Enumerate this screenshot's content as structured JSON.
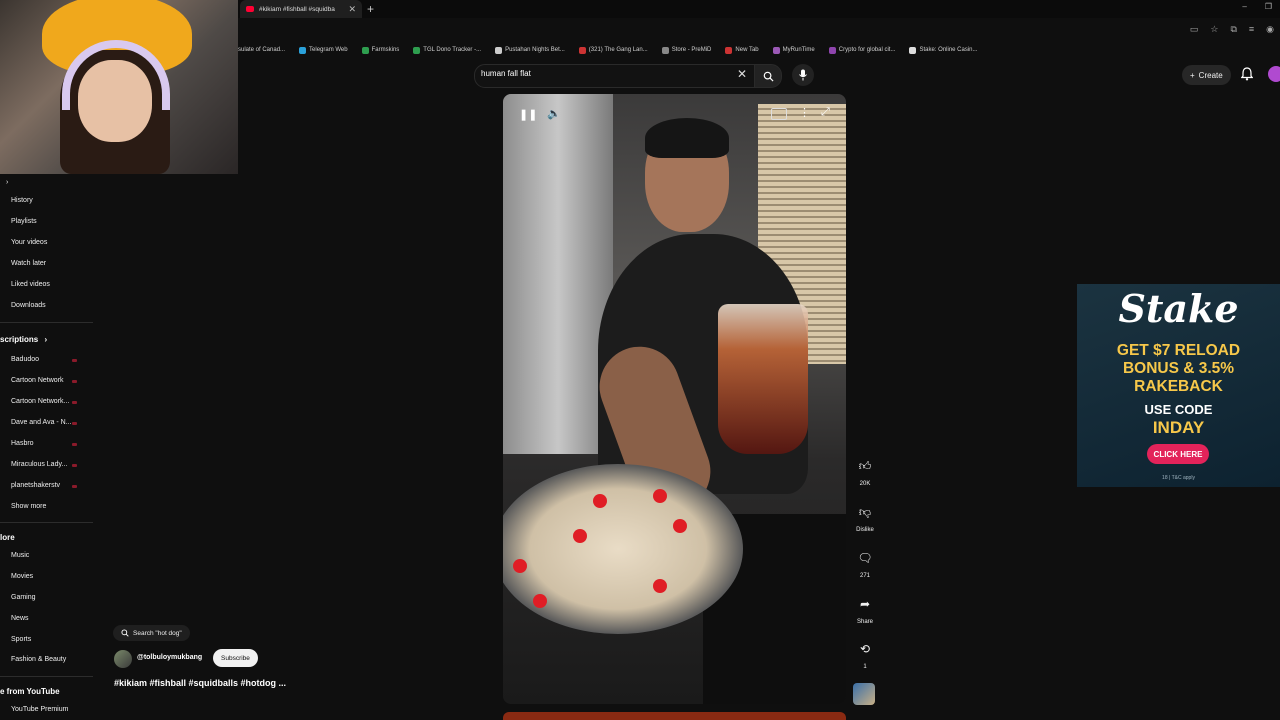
{
  "browser": {
    "tab_title": "#kikiam #fishball #squidba",
    "bookmarks": [
      "sulate of Canad...",
      "Telegram Web",
      "Farmskins",
      "TGL Dono Tracker -...",
      "Pustahan Nights Bet...",
      "(321) The Gang Lan...",
      "Store - PreMiD",
      "New Tab",
      "MyRunTime",
      "Crypto for global cit...",
      "Stake: Online Casin..."
    ]
  },
  "header": {
    "search_value": "human fall flat",
    "create_label": "Create"
  },
  "sidebar": {
    "you_items": [
      "History",
      "Playlists",
      "Your videos",
      "Watch later",
      "Liked videos",
      "Downloads"
    ],
    "subscriptions_heading": "scriptions",
    "subscriptions": [
      "Badudoo",
      "Cartoon Network",
      "Cartoon Network...",
      "Dave and Ava - N...",
      "Hasbro",
      "Miraculous Lady...",
      "planetshakerstv"
    ],
    "show_more": "Show more",
    "explore_heading": "lore",
    "explore_items": [
      "Music",
      "Movies",
      "Gaming",
      "News",
      "Sports",
      "Fashion & Beauty"
    ],
    "more_heading": "e from YouTube",
    "more_items": [
      "YouTube Premium"
    ]
  },
  "video": {
    "search_pill": "Search \"hot dog\"",
    "channel": "@tolbuloymukbang",
    "subscribe_label": "Subscribe",
    "title": "#kikiam #fishball #squidballs #hotdog ..."
  },
  "actions": {
    "likes": "20K",
    "dislike_label": "Dislike",
    "comments": "271",
    "share_label": "Share",
    "remix": "1"
  },
  "ad": {
    "brand": "Stake",
    "headline_lines": [
      "GET $7 RELOAD",
      "BONUS & 3.5%",
      "RAKEBACK"
    ],
    "use_code": "USE CODE",
    "code": "INDAY",
    "cta": "CLICK HERE",
    "terms": "18 | T&C apply"
  }
}
